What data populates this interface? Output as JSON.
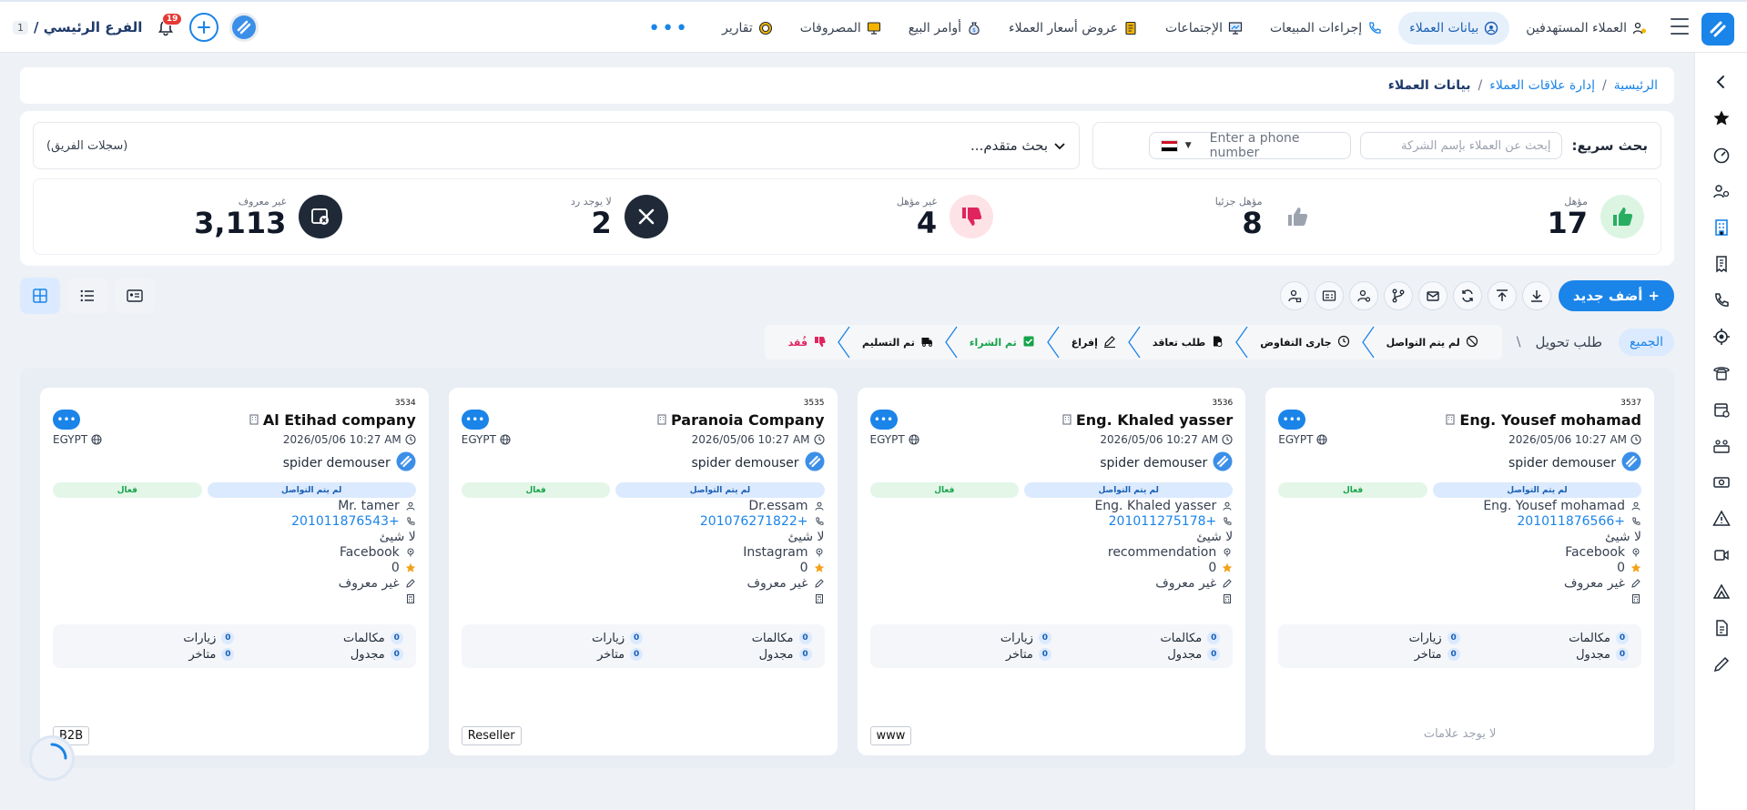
{
  "topnav": {
    "items": [
      {
        "label": "العملاء المستهدفين",
        "icon": "target-users-icon",
        "active": false
      },
      {
        "label": "بيانات العملاء",
        "icon": "contact-icon",
        "active": true
      },
      {
        "label": "إجراءات المبيعات",
        "icon": "phone-icon",
        "active": false
      },
      {
        "label": "الإجتماعات",
        "icon": "presentation-icon",
        "active": false
      },
      {
        "label": "عروض أسعار العملاء",
        "icon": "document-icon",
        "active": false
      },
      {
        "label": "أوامر البيع",
        "icon": "money-bag-icon",
        "active": false
      },
      {
        "label": "المصروفات",
        "icon": "monitor-icon",
        "active": false
      },
      {
        "label": "تقارير",
        "icon": "chart-circle-icon",
        "active": false
      }
    ],
    "more_label": "•••",
    "branch_name": "الفرع الرئيسي /",
    "branch_number": "1",
    "notification_count": "19"
  },
  "breadcrumb": {
    "home": "الرئيسية",
    "crm": "إدارة علاقات العملاء",
    "current": "بيانات العملاء",
    "sep": "/"
  },
  "search": {
    "quick_label": "بحث سريع:",
    "company_placeholder": "إبحث عن العملاء بإسم الشركة",
    "phone_placeholder": "Enter a phone number",
    "advanced_label": "بحث متقدم...",
    "team_records": "(سجلات الفريق)"
  },
  "stats": [
    {
      "label": "مؤهل",
      "value": "17"
    },
    {
      "label": "مؤهل جزئيا",
      "value": "8"
    },
    {
      "label": "غير مؤهل",
      "value": "4"
    },
    {
      "label": "لا يوجد رد",
      "value": "2"
    },
    {
      "label": "غير معروف",
      "value": "3,113"
    }
  ],
  "toolbar": {
    "add_label": "أضف جديد",
    "add_plus": "+"
  },
  "stages": {
    "all_label": "الجميع",
    "conversion_label": "طلب تحويل",
    "slash": "\\",
    "items": [
      {
        "label": "لم يتم التواصل",
        "color": "#111111"
      },
      {
        "label": "جارى التفاوض",
        "color": "#111111"
      },
      {
        "label": "طلب تعاقد",
        "color": "#111111"
      },
      {
        "label": "إفراغ",
        "color": "#111111"
      },
      {
        "label": "تم الشراء",
        "color": "#16a34a"
      },
      {
        "label": "تم التسليم",
        "color": "#111111"
      },
      {
        "label": "فُقد",
        "color": "#e0245e"
      }
    ]
  },
  "cards": [
    {
      "id": "3537",
      "name": "Eng. Yousef mohamad",
      "datetime": "2026/05/06 10:27 AM",
      "country": "EGYPT",
      "owner": "spider demouser",
      "status": "لم يتم التواصل",
      "state": "فعال",
      "contact": "Eng. Yousef mohamad",
      "phone": "+201011876566",
      "nothing": "لا شيئ",
      "source": "Facebook",
      "rating": "0",
      "qualification": "غير معروف",
      "calls_label": "مكالمات",
      "calls": "0",
      "visits_label": "زيارات",
      "visits": "0",
      "scheduled_label": "مجدول",
      "scheduled": "0",
      "late_label": "متاخر",
      "late": "0",
      "tag": "",
      "no_tags": "لا يوجد علامات"
    },
    {
      "id": "3536",
      "name": "Eng. Khaled yasser",
      "datetime": "2026/05/06 10:27 AM",
      "country": "EGYPT",
      "owner": "spider demouser",
      "status": "لم يتم التواصل",
      "state": "فعال",
      "contact": "Eng. Khaled yasser",
      "phone": "+201011275178",
      "nothing": "لا شيئ",
      "source": "recommendation",
      "rating": "0",
      "qualification": "غير معروف",
      "calls_label": "مكالمات",
      "calls": "0",
      "visits_label": "زيارات",
      "visits": "0",
      "scheduled_label": "مجدول",
      "scheduled": "0",
      "late_label": "متاخر",
      "late": "0",
      "tag": "www",
      "no_tags": ""
    },
    {
      "id": "3535",
      "name": "Paranoia Company",
      "datetime": "2026/05/06 10:27 AM",
      "country": "EGYPT",
      "owner": "spider demouser",
      "status": "لم يتم التواصل",
      "state": "فعال",
      "contact": "Dr.essam",
      "phone": "+201076271822",
      "nothing": "لا شيئ",
      "source": "Instagram",
      "rating": "0",
      "qualification": "غير معروف",
      "calls_label": "مكالمات",
      "calls": "0",
      "visits_label": "زيارات",
      "visits": "0",
      "scheduled_label": "مجدول",
      "scheduled": "0",
      "late_label": "متاخر",
      "late": "0",
      "tag": "Reseller",
      "no_tags": ""
    },
    {
      "id": "3534",
      "name": "Al Etihad company",
      "datetime": "2026/05/06 10:27 AM",
      "country": "EGYPT",
      "owner": "spider demouser",
      "status": "لم يتم التواصل",
      "state": "فعال",
      "contact": "Mr. tamer",
      "phone": "+201011876543",
      "nothing": "لا شيئ",
      "source": "Facebook",
      "rating": "0",
      "qualification": "غير معروف",
      "calls_label": "مكالمات",
      "calls": "0",
      "visits_label": "زيارات",
      "visits": "0",
      "scheduled_label": "مجدول",
      "scheduled": "0",
      "late_label": "متاخر",
      "late": "0",
      "tag": "B2B",
      "no_tags": ""
    }
  ],
  "next_cards": [
    {
      "id": "3533"
    },
    {
      "id": "3532"
    },
    {
      "id": "3531"
    },
    {
      "id": "3530"
    }
  ]
}
